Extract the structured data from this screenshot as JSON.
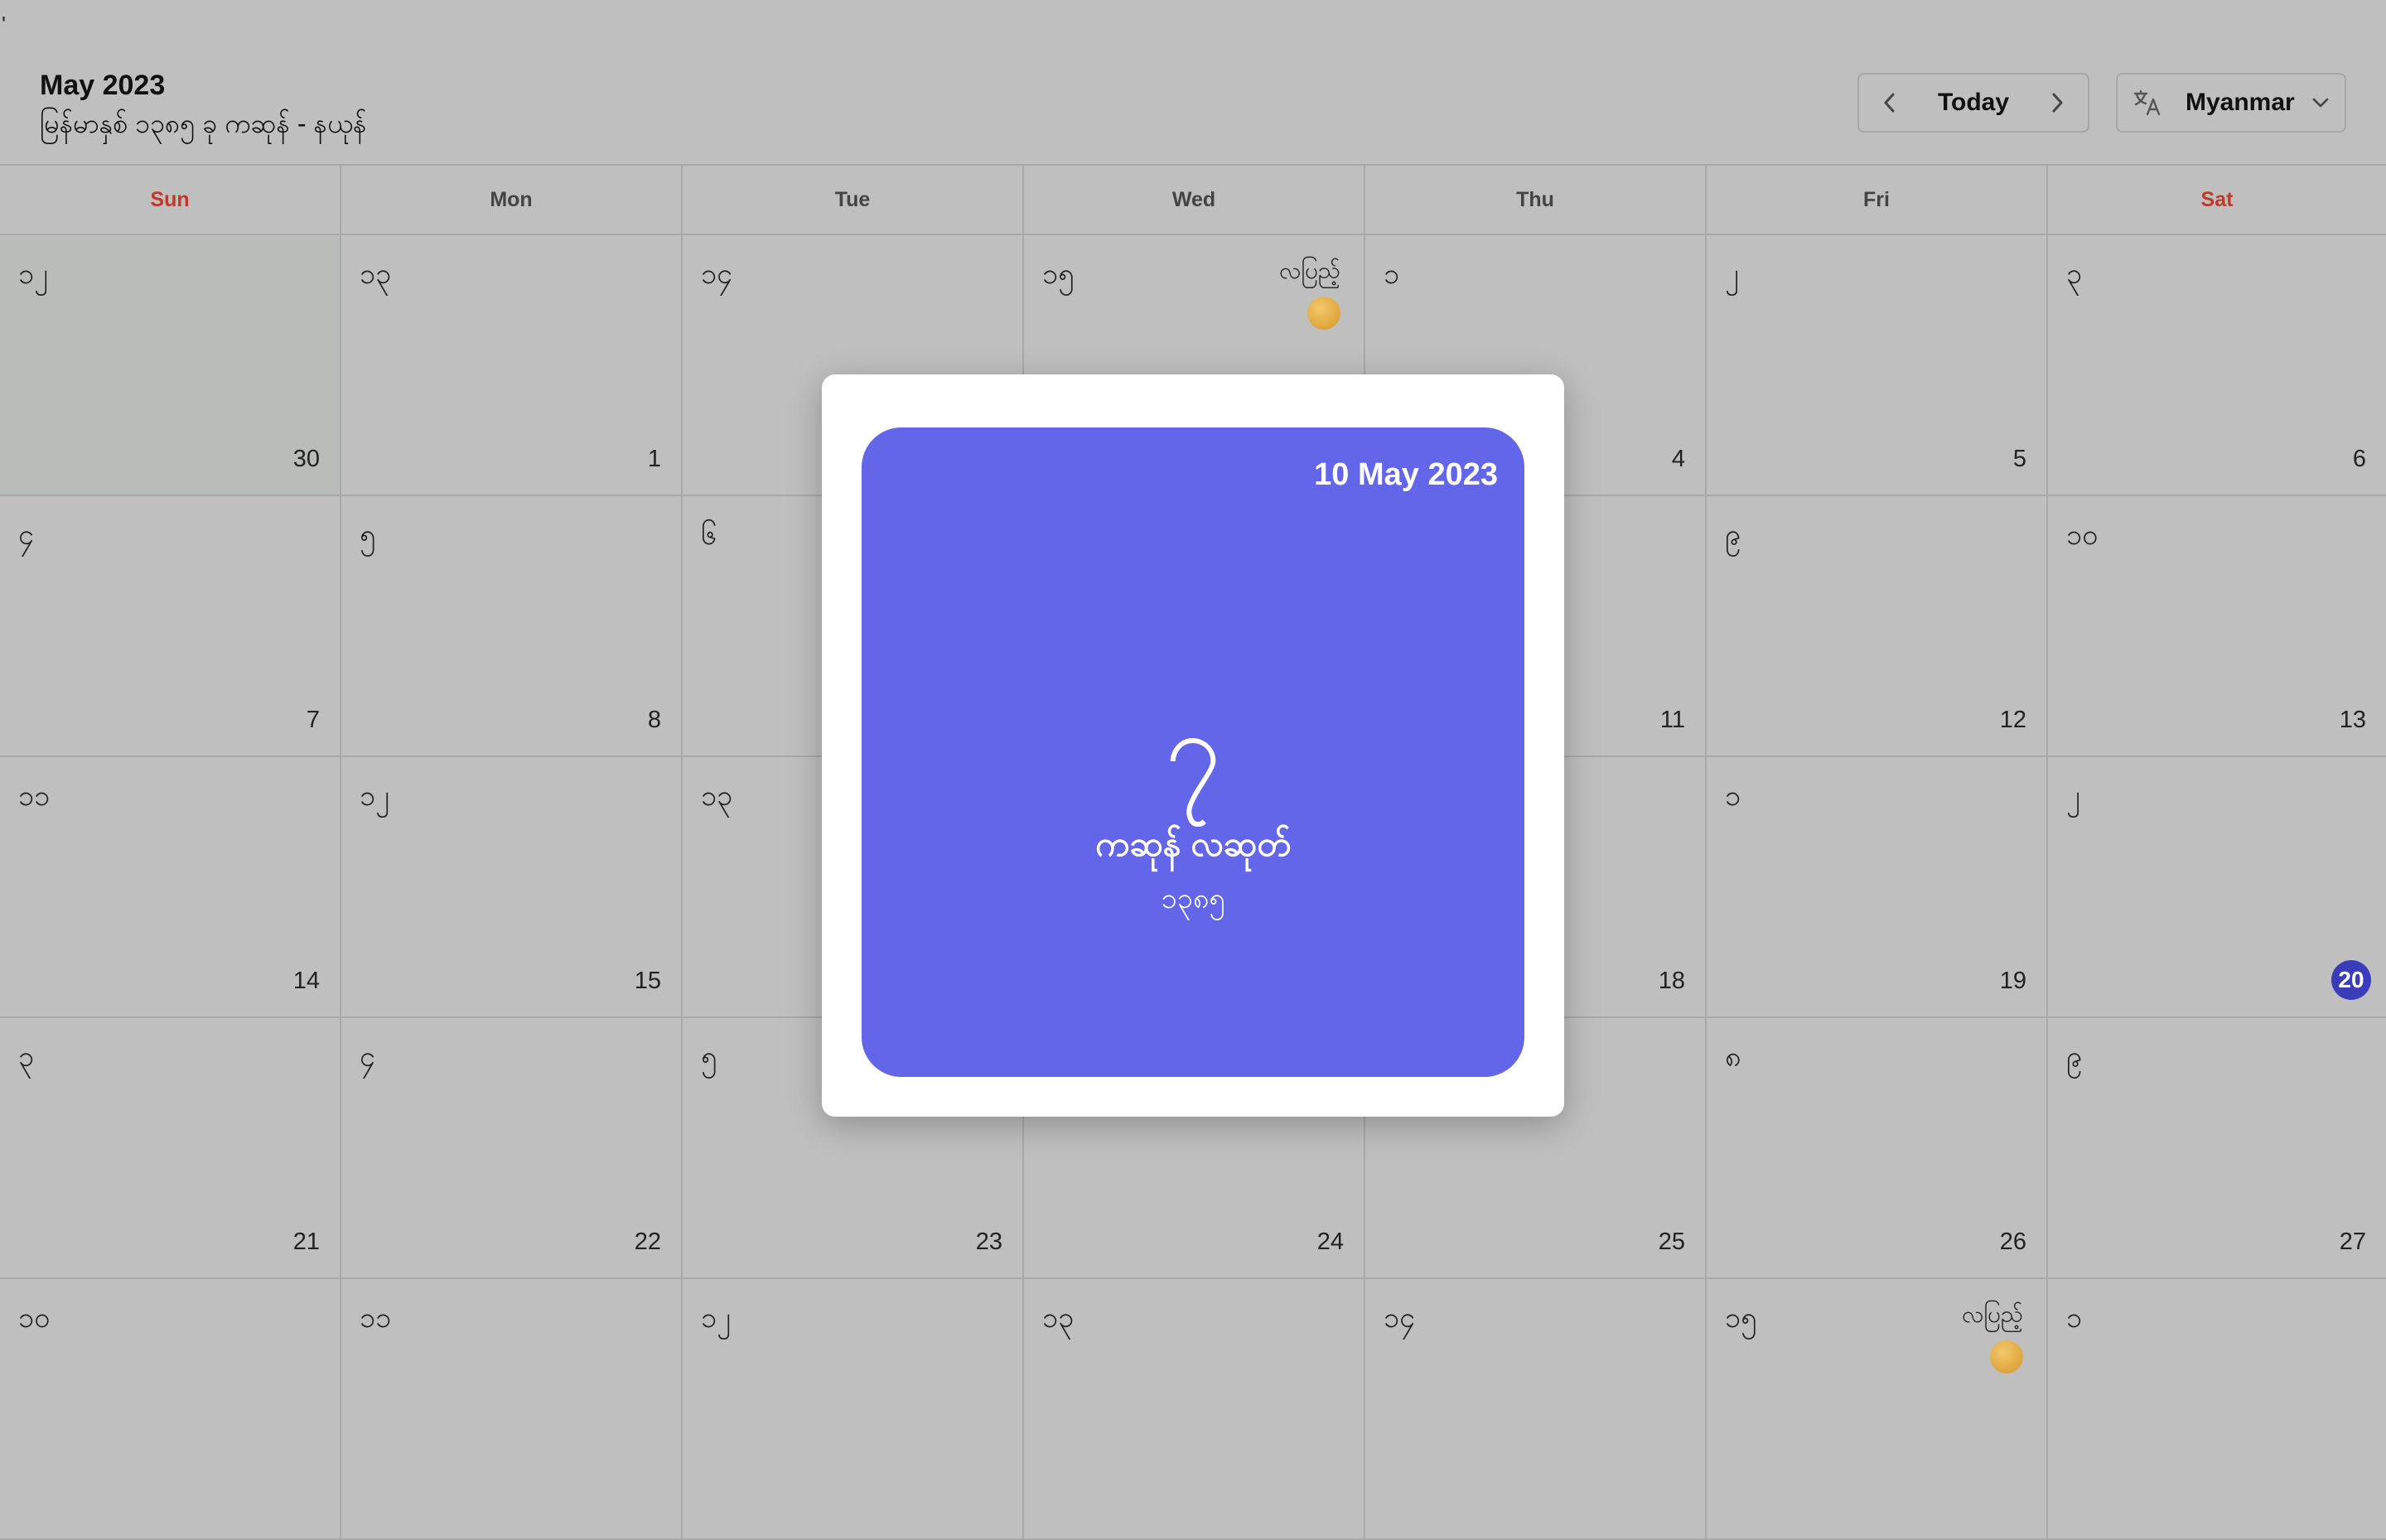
{
  "top_tick": "'",
  "header": {
    "title": "May 2023",
    "subtitle": "မြန်မာနှစ် ၁၃၈၅ ခု ကဆုန် - နယုန်",
    "nav": {
      "today_label": "Today"
    },
    "language": {
      "label": "Myanmar"
    }
  },
  "weekdays": [
    "Sun",
    "Mon",
    "Tue",
    "Wed",
    "Thu",
    "Fri",
    "Sat"
  ],
  "calendar": {
    "weeks": [
      [
        {
          "mm": "၁၂",
          "greg": "30",
          "other": true
        },
        {
          "mm": "၁၃",
          "greg": "1"
        },
        {
          "mm": "၁၄",
          "greg": ""
        },
        {
          "mm": "၁၅",
          "greg": "",
          "phase": "လပြည့်",
          "moon": true
        },
        {
          "mm": "၁",
          "greg": "4"
        },
        {
          "mm": "၂",
          "greg": "5"
        },
        {
          "mm": "၃",
          "greg": "6"
        }
      ],
      [
        {
          "mm": "၄",
          "greg": "7"
        },
        {
          "mm": "၅",
          "greg": "8"
        },
        {
          "mm": "၆",
          "greg": ""
        },
        {
          "mm": "",
          "greg": ""
        },
        {
          "mm": "",
          "greg": "11"
        },
        {
          "mm": "၉",
          "greg": "12"
        },
        {
          "mm": "၁၀",
          "greg": "13"
        }
      ],
      [
        {
          "mm": "၁၁",
          "greg": "14"
        },
        {
          "mm": "၁၂",
          "greg": "15"
        },
        {
          "mm": "၁၃",
          "greg": ""
        },
        {
          "mm": "",
          "greg": ""
        },
        {
          "mm": "",
          "greg": "18"
        },
        {
          "mm": "၁",
          "greg": "19"
        },
        {
          "mm": "၂",
          "greg": "20",
          "today": true
        }
      ],
      [
        {
          "mm": "၃",
          "greg": "21"
        },
        {
          "mm": "၄",
          "greg": "22"
        },
        {
          "mm": "၅",
          "greg": "23"
        },
        {
          "mm": "",
          "greg": "24"
        },
        {
          "mm": "",
          "greg": "25"
        },
        {
          "mm": "၈",
          "greg": "26"
        },
        {
          "mm": "၉",
          "greg": "27"
        }
      ],
      [
        {
          "mm": "၁၀",
          "greg": ""
        },
        {
          "mm": "၁၁",
          "greg": ""
        },
        {
          "mm": "၁၂",
          "greg": ""
        },
        {
          "mm": "၁၃",
          "greg": ""
        },
        {
          "mm": "၁၄",
          "greg": ""
        },
        {
          "mm": "၁၅",
          "greg": "",
          "phase": "လပြည့်",
          "moon": true
        },
        {
          "mm": "၁",
          "greg": ""
        }
      ]
    ]
  },
  "modal": {
    "date": "10 May 2023",
    "mm_day": "၇",
    "mm_month": "ကဆုန် လဆုတ်",
    "mm_year": "၁၃၈၅",
    "card_color": "#6366e8"
  },
  "colors": {
    "accent": "#6366e8",
    "weekend": "#c0392b",
    "today_badge": "#3b3db8"
  }
}
